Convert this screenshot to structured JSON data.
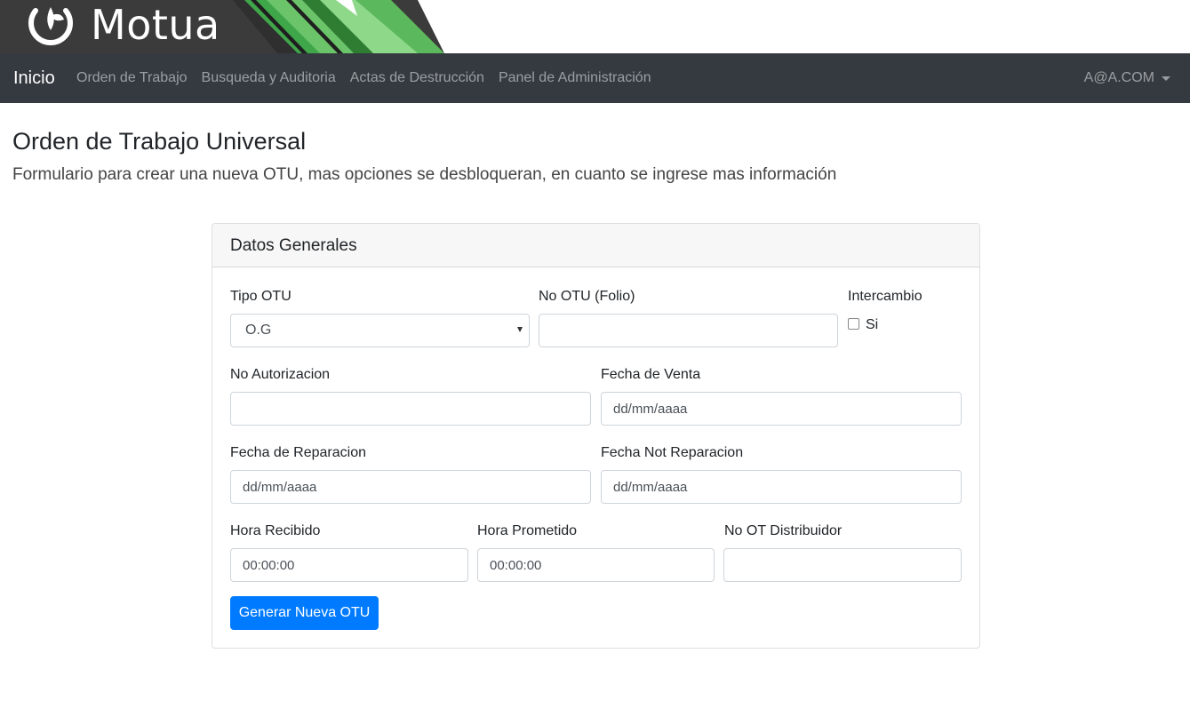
{
  "brand_logo": {
    "text": "Motua",
    "colors": {
      "dark": "#3a3a3a",
      "green_light": "#7ed07a",
      "green_mid": "#3fa64a",
      "green_dark": "#2e7d32"
    }
  },
  "navbar": {
    "brand": "Inicio",
    "items": [
      {
        "label": "Orden de Trabajo"
      },
      {
        "label": "Busqueda y Auditoria"
      },
      {
        "label": "Actas de Destrucción"
      },
      {
        "label": "Panel de Administración"
      }
    ],
    "user": "A@A.COM",
    "background": "#343a40"
  },
  "page": {
    "title": "Orden de Trabajo Universal",
    "lead": "Formulario para crear una nueva OTU, mas opciones se desbloqueran, en cuanto se ingrese mas información"
  },
  "form": {
    "header": "Datos Generales",
    "tipo_otu": {
      "label": "Tipo OTU",
      "value": "O.G"
    },
    "no_otu": {
      "label": "No OTU (Folio)",
      "value": ""
    },
    "intercambio": {
      "label": "Intercambio",
      "option_label": "Si",
      "checked": false
    },
    "no_autorizacion": {
      "label": "No Autorizacion",
      "value": ""
    },
    "fecha_venta": {
      "label": "Fecha de Venta",
      "placeholder": "dd/mm/aaaa"
    },
    "fecha_reparacion": {
      "label": "Fecha de Reparacion",
      "placeholder": "dd/mm/aaaa"
    },
    "fecha_not_reparacion": {
      "label": "Fecha Not Reparacion",
      "placeholder": "dd/mm/aaaa"
    },
    "hora_recibido": {
      "label": "Hora Recibido",
      "placeholder": "00:00:00"
    },
    "hora_prometido": {
      "label": "Hora Prometido",
      "placeholder": "00:00:00"
    },
    "no_ot_distribuidor": {
      "label": "No OT Distribuidor",
      "value": ""
    },
    "submit_label": "Generar Nueva OTU",
    "accent": "#007bff"
  }
}
